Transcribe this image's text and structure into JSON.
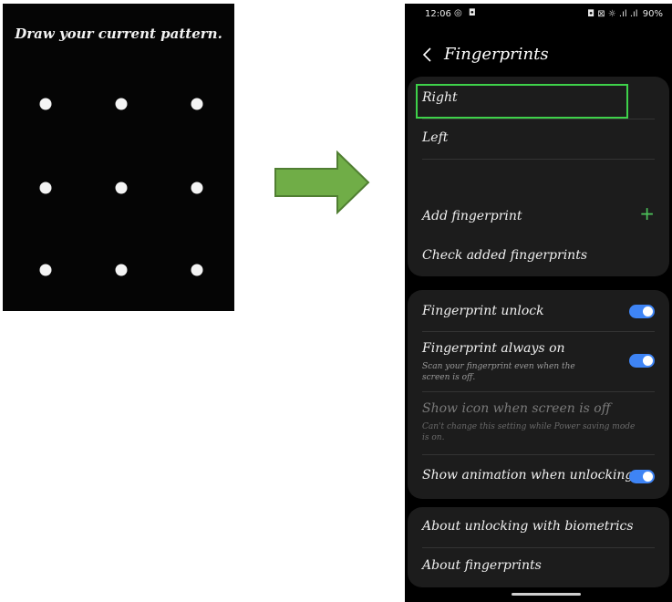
{
  "pattern_screen": {
    "title": "Draw your current pattern."
  },
  "status_bar": {
    "time": "12:06",
    "left_icons": "◎ ◘",
    "right_icons": "◘ ⊠ ☼ .ıl .ıl",
    "battery": "90%"
  },
  "header": {
    "title": "Fingerprints",
    "back_icon": "chevron-left-icon"
  },
  "fingerprints": {
    "items": [
      {
        "label": "Right"
      },
      {
        "label": "Left"
      }
    ],
    "add_label": "Add fingerprint",
    "check_label": "Check added fingerprints"
  },
  "options": {
    "unlock_label": "Fingerprint unlock",
    "always_on_label": "Fingerprint always on",
    "always_on_sub": "Scan your fingerprint even when the screen is off.",
    "show_icon_label": "Show icon when screen is off",
    "show_icon_sub": "Can't change this setting while Power saving mode is on.",
    "animation_label": "Show animation when unlocking"
  },
  "about": {
    "biometrics_label": "About unlocking with biometrics",
    "fingerprints_label": "About fingerprints"
  },
  "colors": {
    "highlight": "#3ed14a",
    "toggle_on": "#3e84f5",
    "arrow_fill": "#70ad47",
    "arrow_stroke": "#507e32"
  }
}
